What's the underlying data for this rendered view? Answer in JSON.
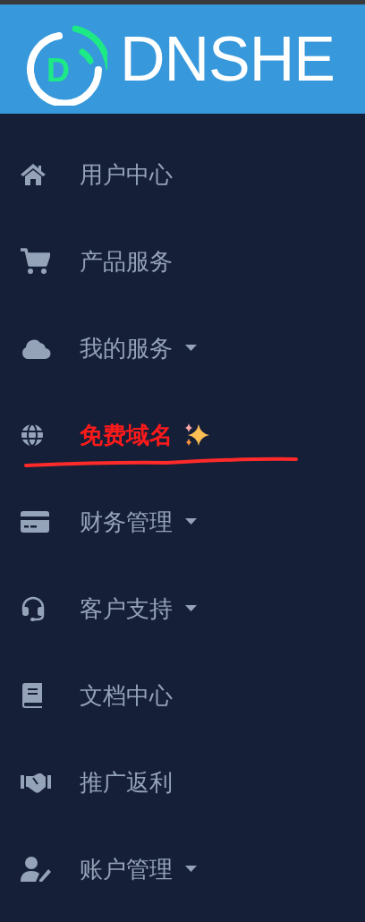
{
  "logo": {
    "mark_letter": "D",
    "wordmark": "DNSHE"
  },
  "menu": [
    {
      "kind": "home",
      "label": "用户中心",
      "dropdown": false,
      "highlighted": false
    },
    {
      "kind": "cart",
      "label": "产品服务",
      "dropdown": false,
      "highlighted": false
    },
    {
      "kind": "cloud",
      "label": "我的服务",
      "dropdown": true,
      "highlighted": false
    },
    {
      "kind": "globe",
      "label": "免费域名",
      "dropdown": false,
      "highlighted": true
    },
    {
      "kind": "card",
      "label": "财务管理",
      "dropdown": true,
      "highlighted": false
    },
    {
      "kind": "headset",
      "label": "客户支持",
      "dropdown": true,
      "highlighted": false
    },
    {
      "kind": "book",
      "label": "文档中心",
      "dropdown": false,
      "highlighted": false
    },
    {
      "kind": "handshake",
      "label": "推广返利",
      "dropdown": false,
      "highlighted": false
    },
    {
      "kind": "user-edit",
      "label": "账户管理",
      "dropdown": true,
      "highlighted": false
    }
  ]
}
